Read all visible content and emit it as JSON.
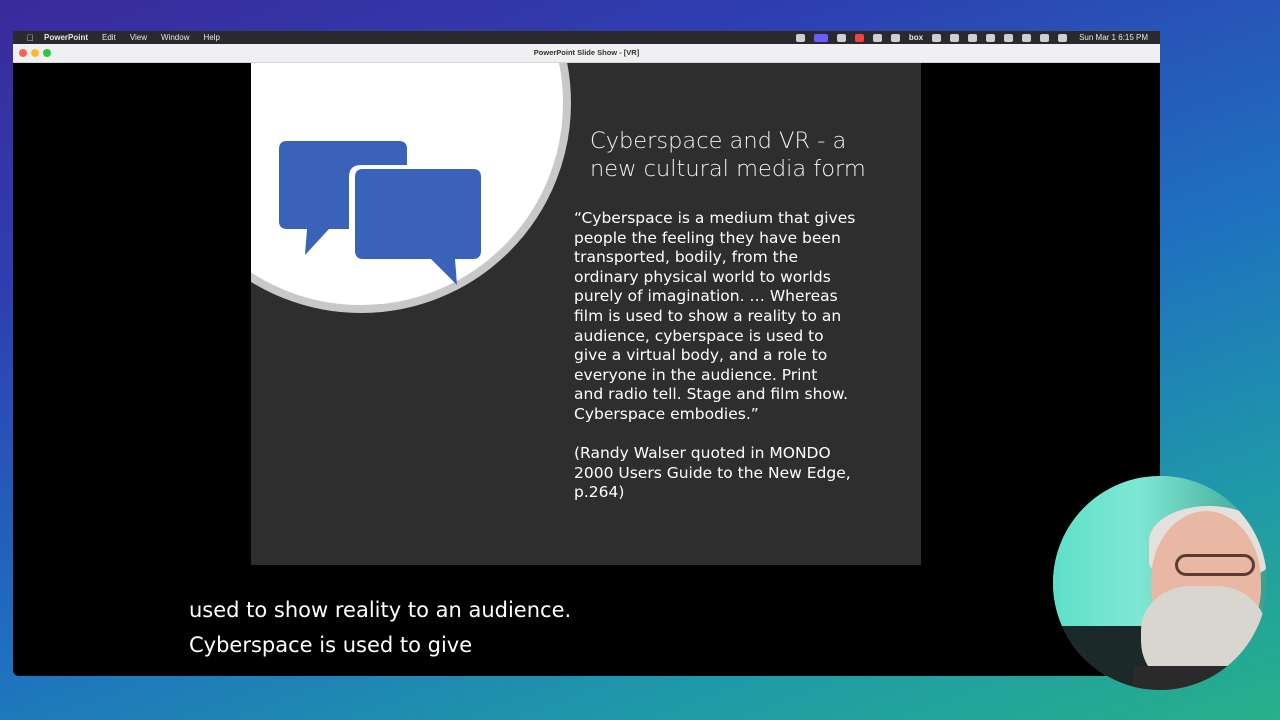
{
  "menubar": {
    "app_name": "PowerPoint",
    "items": [
      "Edit",
      "View",
      "Window",
      "Help"
    ],
    "status_box_label": "box",
    "clock": "Sun Mar 1  6:15 PM"
  },
  "window": {
    "title": "PowerPoint Slide Show - [VR]"
  },
  "slide": {
    "title_line1": "Cyberspace and VR - a",
    "title_line2": "new cultural media form",
    "quote_lines": [
      "“Cyberspace is a medium that gives",
      "people the feeling they have been",
      "transported, bodily, from the",
      "ordinary physical world to worlds",
      "purely of imagination. … Whereas",
      "film is used to show a reality to an",
      "audience, cyberspace is used to",
      "give a virtual body, and a role to",
      "everyone in the audience. Print",
      "and radio tell. Stage and film show.",
      "Cyberspace embodies.”"
    ],
    "citation_lines": [
      "(Randy Walser quoted in MONDO",
      "2000 Users Guide to the New Edge,",
      "p.264)"
    ],
    "icon": "chat-bubbles-icon",
    "icon_color": "#3a62b8"
  },
  "captions": {
    "line1": "used to show reality to an audience.",
    "line2": "Cyberspace is used to give"
  }
}
